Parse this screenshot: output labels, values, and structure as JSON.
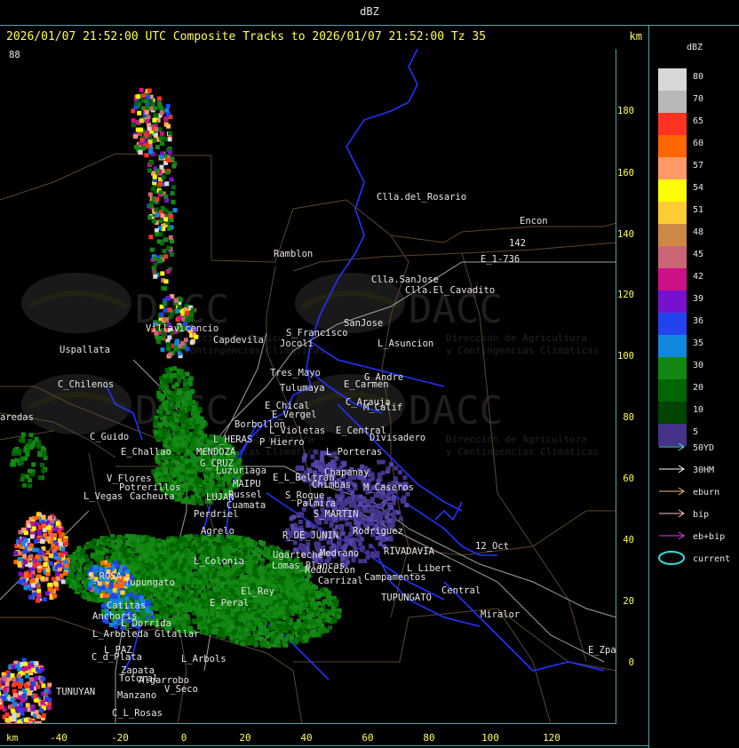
{
  "window_title": "dBZ",
  "header": {
    "title": "2026/01/07 21:52:00 UTC Composite Tracks to 2026/01/07 21:52:00 Tz 35",
    "unit": "km"
  },
  "x_axis": {
    "unit": "km",
    "ticks": [
      "-40",
      "-20",
      "0",
      "20",
      "40",
      "60",
      "80",
      "100",
      "120"
    ]
  },
  "y_axis": {
    "ticks": [
      "180",
      "160",
      "140",
      "120",
      "100",
      "80",
      "60",
      "40",
      "20",
      "0"
    ]
  },
  "watermark": {
    "brand": "DACC",
    "line1": "Dirección de Agricultura",
    "line2": "y Contingencias Climáticas"
  },
  "legend": {
    "title": "dBZ",
    "levels": [
      {
        "label": "80",
        "color": "#d8d8d8"
      },
      {
        "label": "70",
        "color": "#b8b8b8"
      },
      {
        "label": "65",
        "color": "#ff3322"
      },
      {
        "label": "60",
        "color": "#ff6600"
      },
      {
        "label": "57",
        "color": "#ff9966"
      },
      {
        "label": "54",
        "color": "#ffff00"
      },
      {
        "label": "51",
        "color": "#ffcc33"
      },
      {
        "label": "48",
        "color": "#cc8844"
      },
      {
        "label": "45",
        "color": "#cc6677"
      },
      {
        "label": "42",
        "color": "#cc1188"
      },
      {
        "label": "39",
        "color": "#7711cc"
      },
      {
        "label": "36",
        "color": "#2244ee"
      },
      {
        "label": "35",
        "color": "#1188dd"
      },
      {
        "label": "30",
        "color": "#118811"
      },
      {
        "label": "20",
        "color": "#006600"
      },
      {
        "label": "10",
        "color": "#004400"
      },
      {
        "label": "5",
        "color": "#443388"
      }
    ],
    "tracks": [
      {
        "label": "50YD",
        "color": "#66e0e0"
      },
      {
        "label": "30HM",
        "color": "#ffffff"
      },
      {
        "label": "eburn",
        "color": "#f0c070"
      },
      {
        "label": "bip",
        "color": "#ffc0c0"
      },
      {
        "label": "eb+bip",
        "color": "#e040e0"
      },
      {
        "label": "current",
        "color": "#33dddd"
      }
    ]
  },
  "place_labels": [
    {
      "name": "Clla.del_Rosario"
    },
    {
      "name": "Encon"
    },
    {
      "name": "142"
    },
    {
      "name": "E_1-736"
    },
    {
      "name": "Ramblon"
    },
    {
      "name": "Clla.SanJose"
    },
    {
      "name": "Clla.El_Cavadito"
    },
    {
      "name": "SanJose"
    },
    {
      "name": "Villavicencio"
    },
    {
      "name": "Capdevila"
    },
    {
      "name": "S_Francisco"
    },
    {
      "name": "Jocoli"
    },
    {
      "name": "L_Asuncion"
    },
    {
      "name": "Uspallata"
    },
    {
      "name": "Tres_Mayo"
    },
    {
      "name": "Tulumaya"
    },
    {
      "name": "G_Andre"
    },
    {
      "name": "E_Carmen"
    },
    {
      "name": "C_Chilenos"
    },
    {
      "name": "E_Chical"
    },
    {
      "name": "E_Vergel"
    },
    {
      "name": "C_Arauja"
    },
    {
      "name": "M_Calif"
    },
    {
      "name": "aredas"
    },
    {
      "name": "Borbollon"
    },
    {
      "name": "L_Violetas"
    },
    {
      "name": "E_Central"
    },
    {
      "name": "Divisadero"
    },
    {
      "name": "C_Guido"
    },
    {
      "name": "L_HERAS"
    },
    {
      "name": "P_Hierro"
    },
    {
      "name": "E_Challao"
    },
    {
      "name": "MENDOZA"
    },
    {
      "name": "L_Porteras"
    },
    {
      "name": "G_CRUZ"
    },
    {
      "name": "Luzuriaga"
    },
    {
      "name": "Chapanay"
    },
    {
      "name": "E_L_Beltran"
    },
    {
      "name": "Chimbas"
    },
    {
      "name": "M_Caseros"
    },
    {
      "name": "MAIPU"
    },
    {
      "name": "Potrerillos"
    },
    {
      "name": "Russel"
    },
    {
      "name": "S_Roque"
    },
    {
      "name": "L_Vegas"
    },
    {
      "name": "Cacheuta"
    },
    {
      "name": "LUJAN"
    },
    {
      "name": "Cuamata"
    },
    {
      "name": "Palmira"
    },
    {
      "name": "Perdriel"
    },
    {
      "name": "S_MARTIN"
    },
    {
      "name": "Agrelo"
    },
    {
      "name": "R_DE_JUNIN"
    },
    {
      "name": "Rodriguez"
    },
    {
      "name": "L_Colonia"
    },
    {
      "name": "Ugarteche"
    },
    {
      "name": "Medrano"
    },
    {
      "name": "RIVADAVIA"
    },
    {
      "name": "12_Oct"
    },
    {
      "name": "Lomas_Blancas"
    },
    {
      "name": "Reduccion"
    },
    {
      "name": "L_Libert"
    },
    {
      "name": "S_ROSA"
    },
    {
      "name": "Tupungato"
    },
    {
      "name": "El_Rey"
    },
    {
      "name": "Carrizal"
    },
    {
      "name": "Campamentos"
    },
    {
      "name": "Central"
    },
    {
      "name": "Catitas"
    },
    {
      "name": "E_Peral"
    },
    {
      "name": "Anchoris"
    },
    {
      "name": "TUPUNGATO"
    },
    {
      "name": "Miralor"
    },
    {
      "name": "L_Dorrida"
    },
    {
      "name": "L_Arboleda"
    },
    {
      "name": "Gltallar"
    },
    {
      "name": "E_Zpal"
    },
    {
      "name": "L_PAZ"
    },
    {
      "name": "C_d_Plata"
    },
    {
      "name": "L_Arbols"
    },
    {
      "name": "Zapata"
    },
    {
      "name": "Algarrobo"
    },
    {
      "name": "Totoral"
    },
    {
      "name": "V_Seco"
    },
    {
      "name": "TUNUYAN"
    },
    {
      "name": "Manzano"
    },
    {
      "name": "C_L_Rosas"
    },
    {
      "name": "V_Flores"
    },
    {
      "name": "88"
    }
  ]
}
